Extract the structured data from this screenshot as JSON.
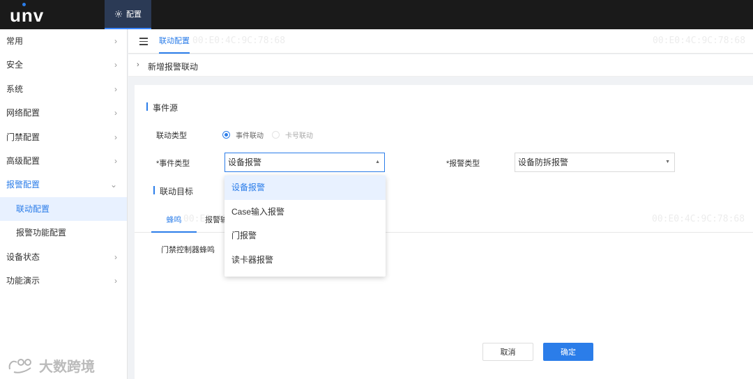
{
  "topbar": {
    "logo": "unv",
    "tab_label": "配置"
  },
  "sidebar": {
    "items": [
      {
        "label": "常用"
      },
      {
        "label": "安全"
      },
      {
        "label": "系统"
      },
      {
        "label": "网络配置"
      },
      {
        "label": "门禁配置"
      },
      {
        "label": "高级配置"
      },
      {
        "label": "报警配置"
      },
      {
        "label": "设备状态"
      },
      {
        "label": "功能演示"
      }
    ],
    "sub_items": [
      {
        "label": "联动配置"
      },
      {
        "label": "报警功能配置"
      }
    ]
  },
  "header": {
    "tab": "联动配置"
  },
  "breadcrumb": {
    "text": "新增报警联动"
  },
  "form": {
    "section1": "事件源",
    "link_type_label": "联动类型",
    "radio_event": "事件联动",
    "radio_card": "卡号联动",
    "event_type_label": "*事件类型",
    "event_type_value": "设备报警",
    "alarm_type_label": "*报警类型",
    "alarm_type_value": "设备防拆报警",
    "section2": "联动目标",
    "tab1": "蜂鸣",
    "tab2": "报警输",
    "buzzer_label": "门禁控制器蜂鸣"
  },
  "dropdown": {
    "options": [
      "设备报警",
      "Case输入报警",
      "门报警",
      "读卡器报警"
    ]
  },
  "buttons": {
    "cancel": "取消",
    "ok": "确定"
  },
  "watermark": {
    "text": "大数跨境"
  },
  "ghost_text": {
    "mac": "00:E0:4C:9C:78:68"
  }
}
